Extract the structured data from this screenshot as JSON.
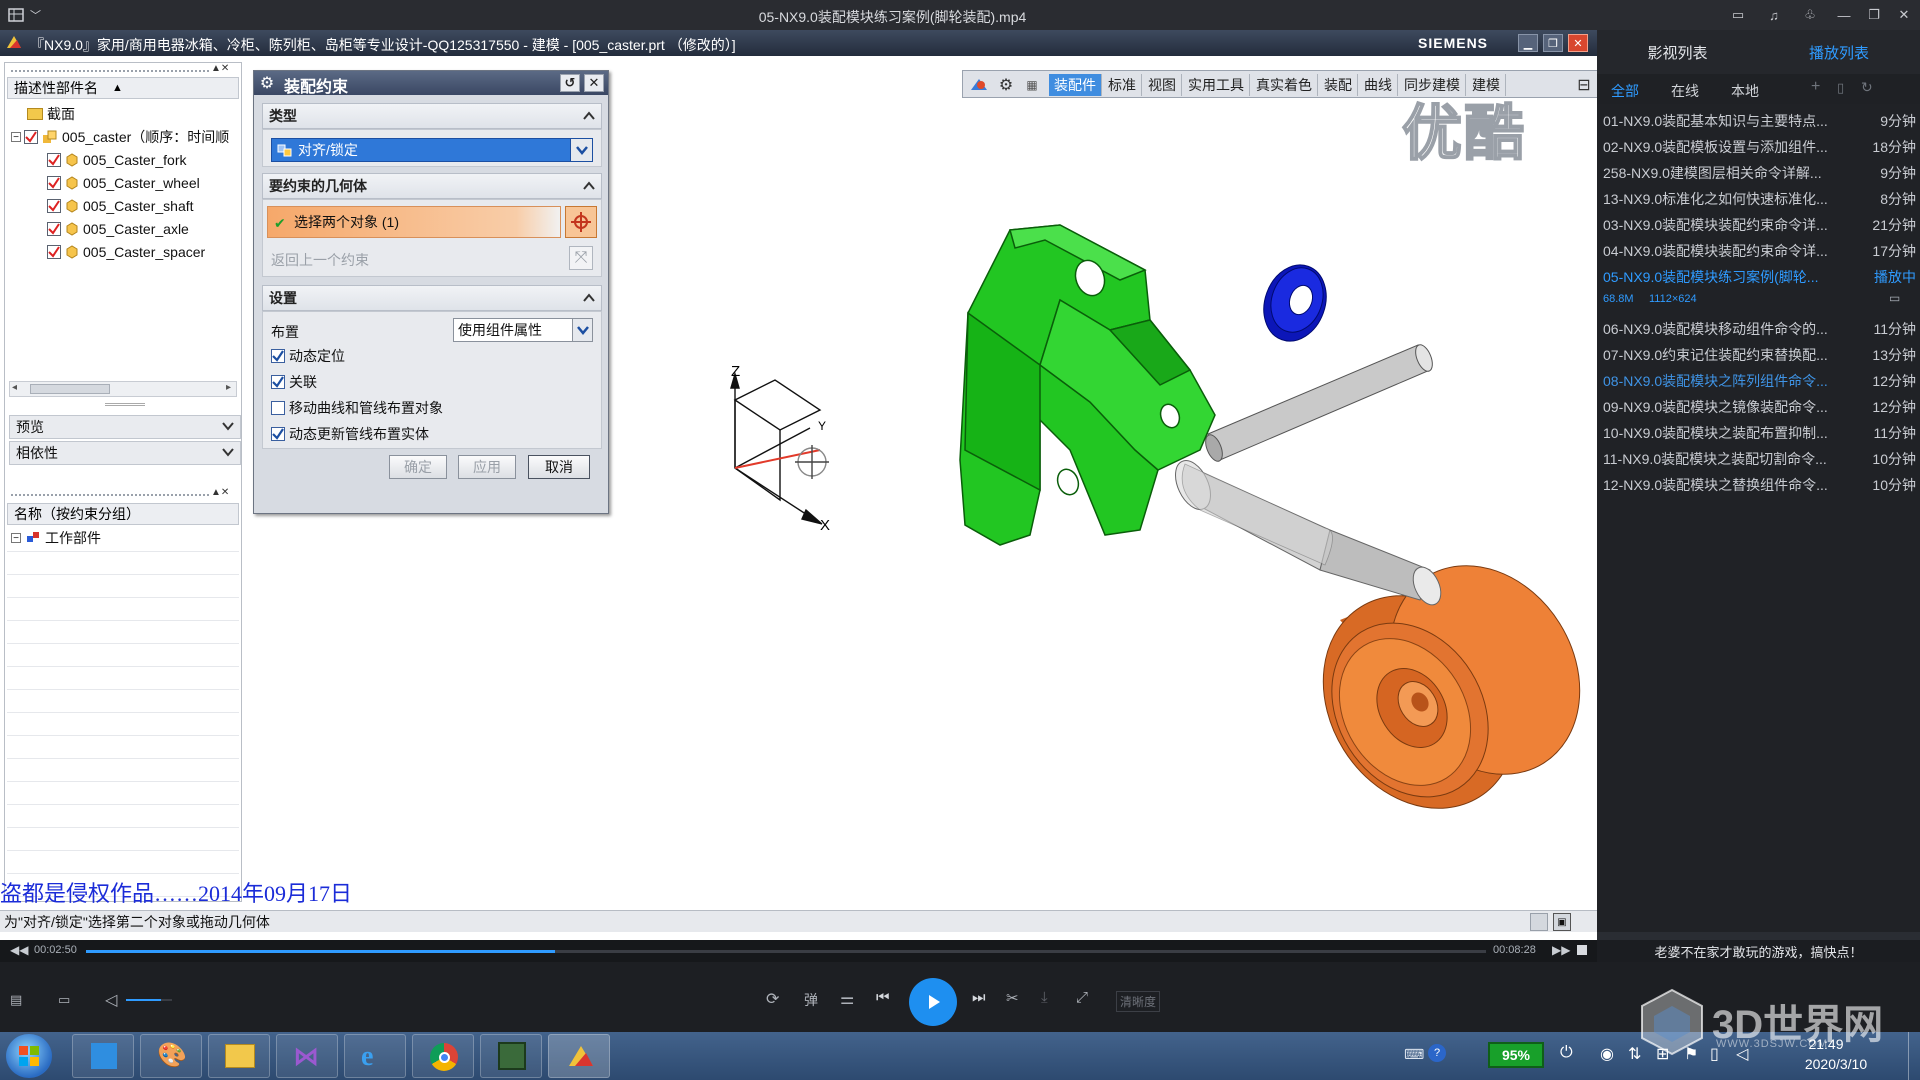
{
  "window": {
    "title": "05-NX9.0装配模块练习案例(脚轮装配).mp4"
  },
  "nx": {
    "title": "『NX9.0』家用/商用电器冰箱、冷柜、陈列柜、岛柜等专业设计-QQ125317550 - 建模 - [005_caster.prt （修改的）]",
    "brand": "SIEMENS",
    "toolbar_tabs": [
      "装配件",
      "标准",
      "视图",
      "实用工具",
      "真实着色",
      "装配",
      "曲线",
      "同步建模",
      "建模"
    ],
    "watermark": "优酷",
    "subtitle": "盗都是侵权作品……2014年09月17日",
    "status_text": "为\"对齐/锁定\"选择第二个对象或拖动几何体",
    "axes": {
      "z": "Z",
      "x": "X",
      "y": "Y"
    }
  },
  "navigator": {
    "column_header": "描述性部件名",
    "tree": [
      {
        "label": "截面",
        "level": 1
      },
      {
        "label": "005_caster（顺序：时间顺",
        "level": 1
      },
      {
        "label": "005_Caster_fork",
        "level": 2
      },
      {
        "label": "005_Caster_wheel",
        "level": 2
      },
      {
        "label": "005_Caster_shaft",
        "level": 2
      },
      {
        "label": "005_Caster_axle",
        "level": 2
      },
      {
        "label": "005_Caster_spacer",
        "level": 2
      }
    ],
    "preview_label": "预览",
    "dependency_label": "相依性",
    "constraint_header": "名称（按约束分组）",
    "constraint_root": "工作部件"
  },
  "dialog": {
    "title": "装配约束",
    "type_section": "类型",
    "type_value": "对齐/锁定",
    "geometry_section": "要约束的几何体",
    "select_objects": "选择两个对象 (1)",
    "return_constraint": "返回上一个约束",
    "settings_section": "设置",
    "layout_label": "布置",
    "layout_value": "使用组件属性",
    "checkboxes": [
      {
        "label": "动态定位",
        "checked": true
      },
      {
        "label": "关联",
        "checked": true
      },
      {
        "label": "移动曲线和管线布置对象",
        "checked": false
      },
      {
        "label": "动态更新管线布置实体",
        "checked": true
      }
    ],
    "ok": "确定",
    "apply": "应用",
    "cancel": "取消"
  },
  "playlist": {
    "tabs": [
      "影视列表",
      "播放列表"
    ],
    "filters": [
      "全部",
      "在线",
      "本地"
    ],
    "items": [
      {
        "title": "01-NX9.0装配基本知识与主要特点...",
        "duration": "9分钟"
      },
      {
        "title": "02-NX9.0装配模板设置与添加组件...",
        "duration": "18分钟"
      },
      {
        "title": "258-NX9.0建模图层相关命令详解...",
        "duration": "9分钟"
      },
      {
        "title": "13-NX9.0标准化之如何快速标准化...",
        "duration": "8分钟"
      },
      {
        "title": "03-NX9.0装配模块装配约束命令详...",
        "duration": "21分钟"
      },
      {
        "title": "04-NX9.0装配模块装配约束命令详...",
        "duration": "17分钟"
      },
      {
        "title": "05-NX9.0装配模块练习案例(脚轮...",
        "duration": "播放中",
        "active": true
      },
      {
        "title": "06-NX9.0装配模块移动组件命令的...",
        "duration": "11分钟"
      },
      {
        "title": "07-NX9.0约束记住装配约束替换配...",
        "duration": "13分钟"
      },
      {
        "title": "08-NX9.0装配模块之阵列组件命令...",
        "duration": "12分钟",
        "highlight": true
      },
      {
        "title": "09-NX9.0装配模块之镜像装配命令...",
        "duration": "12分钟"
      },
      {
        "title": "10-NX9.0装配模块之装配布置抑制...",
        "duration": "11分钟"
      },
      {
        "title": "11-NX9.0装配模块之装配切割命令...",
        "duration": "10分钟"
      },
      {
        "title": "12-NX9.0装配模块之替换组件命令...",
        "duration": "10分钟"
      }
    ],
    "active_meta": {
      "size": "68.8M",
      "resolution": "1112×624"
    },
    "ad_text": "老婆不在家才敢玩的游戏，搞快点！"
  },
  "player": {
    "current_time": "00:02:50",
    "total_time": "00:08:28",
    "progress": 0.335,
    "volume": 0.75,
    "quality_label": "清晰度",
    "danmaku_label": "弹"
  },
  "taskbar": {
    "battery": "95%",
    "time": "21:49",
    "date": "2020/3/10",
    "logo_text": "3D世界网",
    "logo_url_text": "WWW.3DSJW.COM"
  },
  "colors": {
    "accent": "#2f9bff",
    "fork": "#1fd31f",
    "wheel": "#e8762b",
    "spacer": "#1420d8",
    "shaft": "#bcbcbc"
  }
}
